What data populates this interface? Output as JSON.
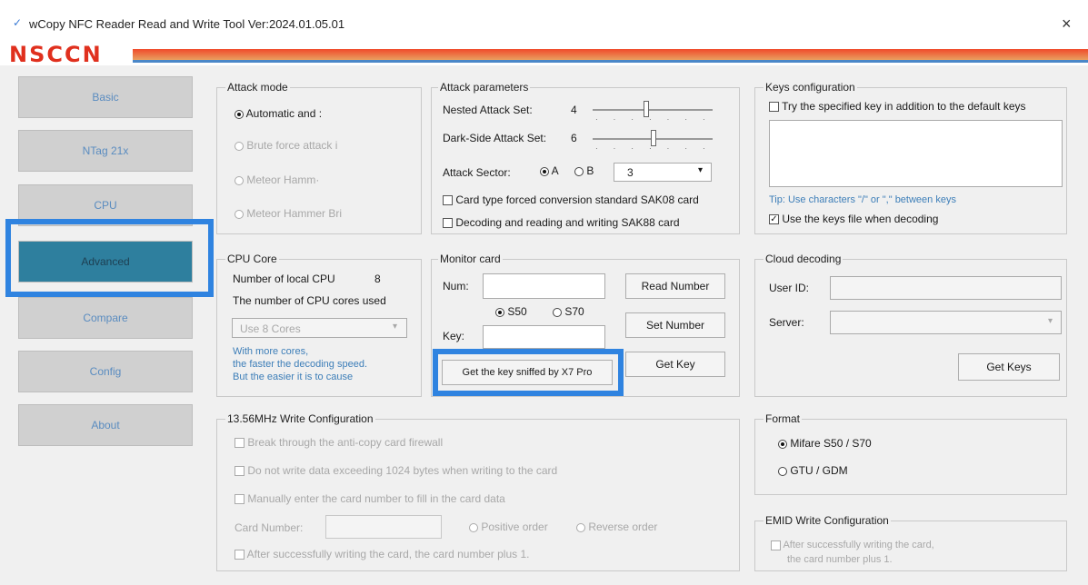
{
  "window": {
    "title": "wCopy NFC Reader Read and Write Tool  Ver:2024.01.05.01",
    "close": "×"
  },
  "logo": "NSCCN",
  "sidebar": {
    "items": [
      "Basic",
      "NTag 21x",
      "CPU",
      "Advanced",
      "Compare",
      "Config",
      "About"
    ],
    "active": "Advanced"
  },
  "attack_mode": {
    "title": "Attack mode",
    "options": [
      "Automatic and :",
      "Brute force attack i",
      "Meteor Hamm·",
      "Meteor Hammer Bri"
    ],
    "selected": 0
  },
  "attack_params": {
    "title": "Attack parameters",
    "nested_label": "Nested Attack Set:",
    "nested_value": "4",
    "darkside_label": "Dark-Side Attack Set:",
    "darkside_value": "6",
    "sector_label": "Attack Sector:",
    "sector_a": "A",
    "sector_b": "B",
    "sector_selected": "A",
    "sector_value": "3",
    "check1": "Card type forced conversion standard SAK08 card",
    "check2": "Decoding and reading and writing SAK88 card"
  },
  "keys_config": {
    "title": "Keys configuration",
    "try_label": "Try the specified key in addition to the default keys",
    "try_checked": false,
    "tip": "Tip: Use characters \"/\" or \",\" between keys",
    "use_keys_label": "Use the keys file when decoding",
    "use_keys_checked": true
  },
  "cpu_core": {
    "title": "CPU Core",
    "local_label": "Number of local CPU",
    "local_value": "8",
    "used_label": "The number of CPU cores used",
    "select_value": "Use 8 Cores",
    "note1": "With more cores,",
    "note2": "the faster the decoding speed.",
    "note3": "But the easier it is to cause"
  },
  "monitor": {
    "title": "Monitor card",
    "num_label": "Num:",
    "key_label": "Key:",
    "s50": "S50",
    "s70": "S70",
    "selected": "S50",
    "read_btn": "Read Number",
    "set_btn": "Set Number",
    "getkey_btn": "Get Key",
    "sniff_btn": "Get the key sniffed by X7 Pro"
  },
  "cloud": {
    "title": "Cloud decoding",
    "user_label": "User ID:",
    "server_label": "Server:",
    "getkeys_btn": "Get Keys"
  },
  "write_cfg": {
    "title": "13.56MHz Write Configuration",
    "opt1": "Break through the anti-copy card firewall",
    "opt2": "Do not write data exceeding 1024 bytes when writing to the card",
    "opt3": "Manually enter the card number to fill in the card data",
    "card_number_label": "Card Number:",
    "positive": "Positive order",
    "reverse": "Reverse order",
    "opt4": "After successfully writing the card, the card number plus 1."
  },
  "format": {
    "title": "Format",
    "opt1": "Mifare S50 / S70",
    "opt2": "GTU / GDM",
    "selected": "Mifare S50 / S70"
  },
  "emid": {
    "title": "EMID Write Configuration",
    "line1": "After successfully writing the card,",
    "line2": "the card number plus 1."
  },
  "colors": {
    "accent": "#2f83e0",
    "active_nav": "#2e7f9e",
    "logo": "#e0301e",
    "tip": "#3d7eb8"
  }
}
